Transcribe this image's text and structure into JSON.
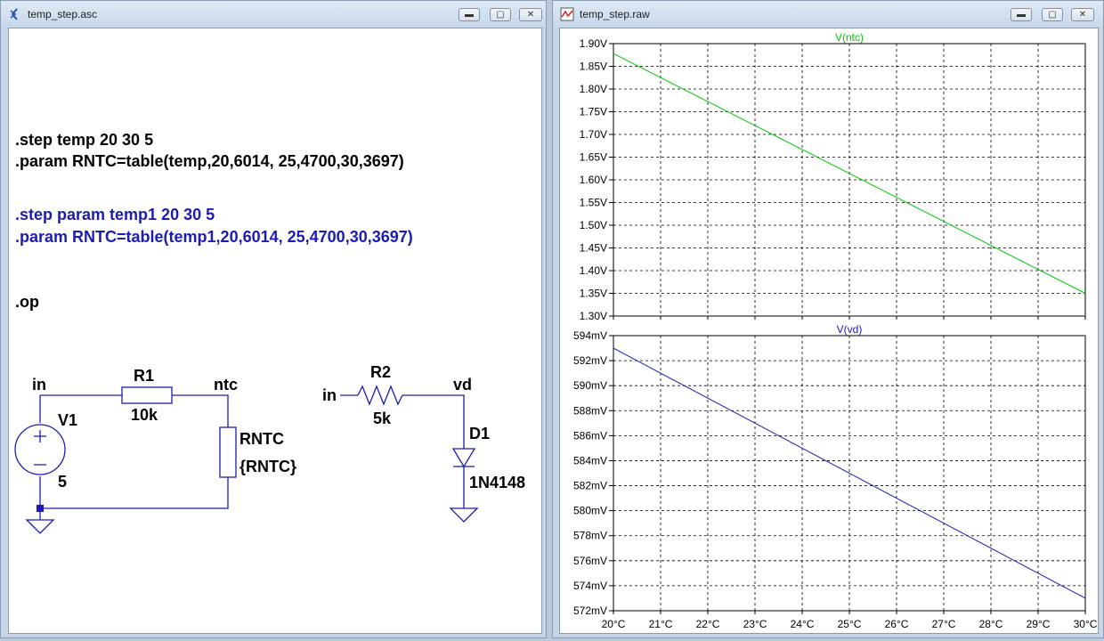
{
  "schematic_window": {
    "title": "temp_step.asc",
    "directives": [
      {
        "text": ".step temp 20 30 5",
        "color": "#000000"
      },
      {
        "text": ".param RNTC=table(temp,20,6014, 25,4700,30,3697)",
        "color": "#000000"
      },
      {
        "text": ".step param temp1 20 30 5",
        "color": "#1c1cb4"
      },
      {
        "text": ".param RNTC=table(temp1,20,6014, 25,4700,30,3697)",
        "color": "#1c1cb4"
      },
      {
        "text": ".op",
        "color": "#000000"
      }
    ],
    "labels": {
      "net_in": "in",
      "net_ntc": "ntc",
      "r1_name": "R1",
      "r1_value": "10k",
      "v1_name": "V1",
      "v1_value": "5",
      "rntc_name": "RNTC",
      "rntc_value": "{RNTC}",
      "net_in2": "in",
      "r2_name": "R2",
      "r2_value": "5k",
      "net_vd": "vd",
      "d1_name": "D1",
      "d1_value": "1N4148"
    },
    "wire_color": "#1c1cb4"
  },
  "plot_window": {
    "title": "temp_step.raw",
    "window_buttons": {
      "min": "▬",
      "max": "▢",
      "close": "✕"
    }
  },
  "schematic_buttons": {
    "min": "▬",
    "max": "▢",
    "close": "✕"
  },
  "chart_data": [
    {
      "type": "line",
      "title": "V(ntc)",
      "color": "#00c800",
      "x": [
        20,
        30
      ],
      "series": [
        {
          "name": "V(ntc)",
          "values": [
            1.878,
            1.35
          ]
        }
      ],
      "xlim": [
        20,
        30
      ],
      "ylim": [
        1.3,
        1.9
      ],
      "yticks": [
        "1.90V",
        "1.85V",
        "1.80V",
        "1.75V",
        "1.70V",
        "1.65V",
        "1.60V",
        "1.55V",
        "1.50V",
        "1.45V",
        "1.40V",
        "1.35V",
        "1.30V"
      ],
      "grid": true
    },
    {
      "type": "line",
      "title": "V(vd)",
      "color": "#1c1cb4",
      "x": [
        20,
        30
      ],
      "series": [
        {
          "name": "V(vd)",
          "values": [
            593.0,
            573.0
          ]
        }
      ],
      "xlim": [
        20,
        30
      ],
      "ylim": [
        572,
        594
      ],
      "yticks": [
        "594mV",
        "592mV",
        "590mV",
        "588mV",
        "586mV",
        "584mV",
        "582mV",
        "580mV",
        "578mV",
        "576mV",
        "574mV",
        "572mV"
      ],
      "xticks": [
        "20°C",
        "21°C",
        "22°C",
        "23°C",
        "24°C",
        "25°C",
        "26°C",
        "27°C",
        "28°C",
        "29°C",
        "30°C"
      ],
      "grid": true
    }
  ]
}
